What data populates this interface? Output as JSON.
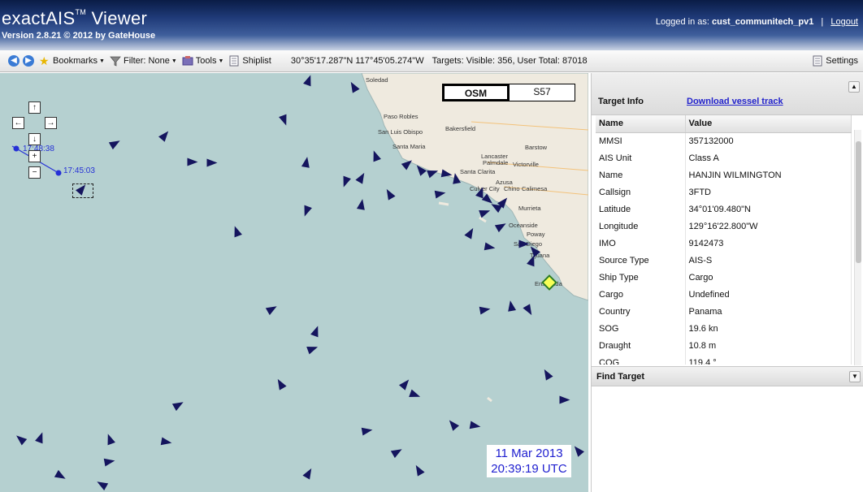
{
  "app": {
    "logo_text": "exactAIS",
    "logo_tm": "TM",
    "logo_suffix": "Viewer",
    "version": "Version 2.8.21 © 2012 by GateHouse",
    "login_prefix": "Logged in as:",
    "login_user": "cust_communitech_pv1",
    "logout_label": "Logout",
    "header_color": "#1f3a78"
  },
  "toolbar": {
    "back_icon": "arrow-left-circle-icon",
    "forward_icon": "arrow-right-circle-icon",
    "bookmarks_label": "Bookmarks",
    "filter_label": "Filter: None",
    "tools_label": "Tools",
    "shiplist_label": "Shiplist",
    "coordinates": "30°35'17.287\"N 117°45'05.274\"W",
    "targets_text": "Targets: Visible: 356, User Total: 87018",
    "settings_label": "Settings"
  },
  "map": {
    "layers": [
      "OSM",
      "S57"
    ],
    "active_layer": "OSM",
    "track_labels": [
      "17:48:38",
      "17:45:03"
    ],
    "places": [
      "Soledad",
      "Paso Robles",
      "San Luis Obispo",
      "Bakersfield",
      "Santa Maria",
      "Barstow",
      "Lancaster",
      "Palmdale",
      "Victorville",
      "Santa Clarita",
      "Azusa",
      "Culver City",
      "Chino",
      "Calimesa",
      "Murrieta",
      "Oceanside",
      "Poway",
      "San Diego",
      "Tijuana",
      "Ensenada"
    ],
    "timestamp_date": "11 Mar 2013",
    "timestamp_time": "20:39:19 UTC",
    "sea_color": "#b5d0d0",
    "land_color": "#efeadf",
    "ship_color": "#15155e"
  },
  "panel": {
    "title": "Target Info",
    "download_label": "Download vessel track",
    "col_name": "Name",
    "col_value": "Value",
    "rows": [
      {
        "k": "MMSI",
        "v": "357132000"
      },
      {
        "k": "AIS Unit",
        "v": "Class A"
      },
      {
        "k": "Name",
        "v": "HANJIN WILMINGTON"
      },
      {
        "k": "Callsign",
        "v": "3FTD"
      },
      {
        "k": "Latitude",
        "v": "34°01'09.480\"N"
      },
      {
        "k": "Longitude",
        "v": "129°16'22.800\"W"
      },
      {
        "k": "IMO",
        "v": "9142473"
      },
      {
        "k": "Source Type",
        "v": "AIS-S"
      },
      {
        "k": "Ship Type",
        "v": "Cargo"
      },
      {
        "k": "Cargo",
        "v": "Undefined"
      },
      {
        "k": "Country",
        "v": "Panama"
      },
      {
        "k": "SOG",
        "v": "19.6 kn"
      },
      {
        "k": "Draught",
        "v": "10.8 m"
      },
      {
        "k": "COG",
        "v": "119.4 °"
      }
    ],
    "find_title": "Find Target"
  }
}
